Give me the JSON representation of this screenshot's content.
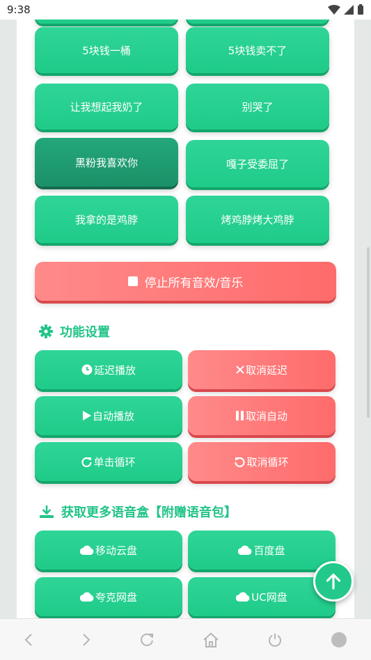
{
  "status": {
    "time": "9:38"
  },
  "sound_buttons": [
    {
      "label": "5块钱一桶"
    },
    {
      "label": "5块钱卖不了"
    },
    {
      "label": "让我想起我奶了"
    },
    {
      "label": "别哭了"
    },
    {
      "label": "黑粉我喜欢你"
    },
    {
      "label": "嘎子受委屈了"
    },
    {
      "label": "我拿的是鸡脖"
    },
    {
      "label": "烤鸡脖烤大鸡脖"
    }
  ],
  "stop_all": {
    "label": "停止所有音效/音乐",
    "icon": "stop-icon"
  },
  "function_settings": {
    "title": "功能设置",
    "icon": "gear-icon",
    "buttons": [
      {
        "label": "延迟播放",
        "icon": "clock-icon"
      },
      {
        "label": "取消延迟",
        "icon": "close-icon"
      },
      {
        "label": "自动播放",
        "icon": "play-icon"
      },
      {
        "label": "取消自动",
        "icon": "pause-icon"
      },
      {
        "label": "单击循环",
        "icon": "redo-icon"
      },
      {
        "label": "取消循环",
        "icon": "undo-icon"
      }
    ]
  },
  "more_boxes": {
    "title": "获取更多语音盒【附赠语音包】",
    "icon": "download-icon",
    "buttons": [
      {
        "label": "移动云盘",
        "icon": "cloud-icon"
      },
      {
        "label": "百度盘",
        "icon": "cloud-icon"
      },
      {
        "label": "夸克网盘",
        "icon": "cloud-icon"
      },
      {
        "label": "UC网盘",
        "icon": "cloud-icon"
      }
    ]
  },
  "colors": {
    "primary_green": "#22c98a",
    "accent_red": "#ff6b6b",
    "background": "#e4e9e7"
  }
}
